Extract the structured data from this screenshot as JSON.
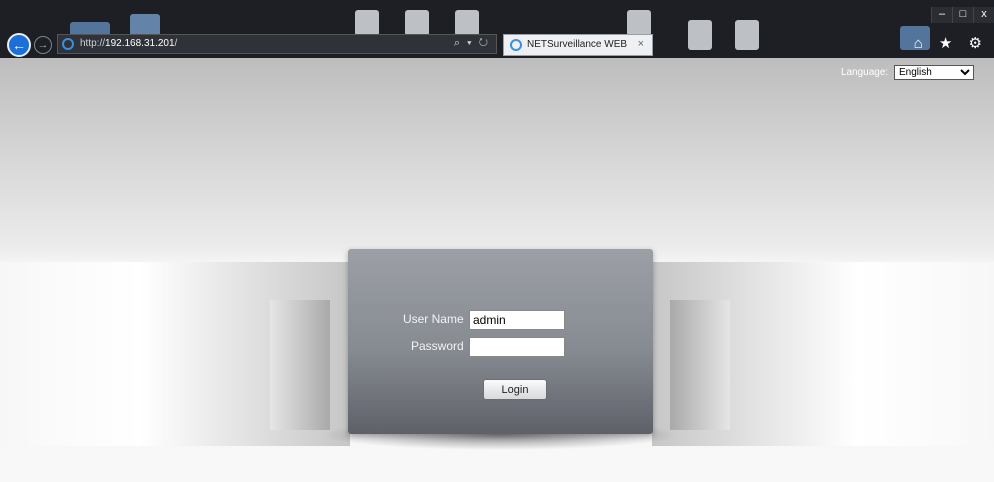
{
  "browser": {
    "url_prefix": "http://",
    "url_host": "192.168.31.201",
    "url_suffix": "/",
    "search_refresh": "⌕ ▾ ↻",
    "tab_title": "NETSurveillance WEB",
    "tab_close": "×",
    "back": "←",
    "forward": "→",
    "min": "–",
    "restore": "□",
    "close": "x",
    "toolbar_icons": "⌂ ★ ⚙"
  },
  "language": {
    "label": "Language:",
    "selected": "English"
  },
  "login": {
    "username_label": "User Name",
    "username_value": "admin",
    "password_label": "Password",
    "password_value": "",
    "button": "Login"
  },
  "icons": [
    "back-arrow-icon",
    "forward-arrow-icon",
    "ie-icon",
    "search-icon",
    "refresh-icon",
    "close-icon",
    "home-icon",
    "favorites-star-icon",
    "settings-gear-icon",
    "dropdown-arrow-icon"
  ]
}
